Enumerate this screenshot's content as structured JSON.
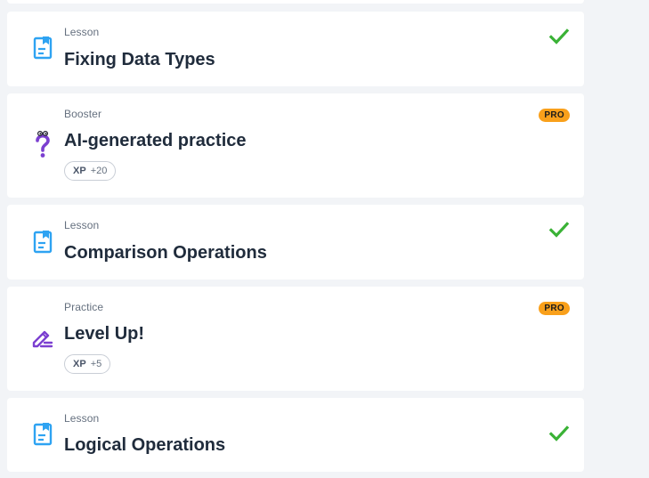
{
  "colors": {
    "lesson_icon": "#2ea3f2",
    "booster_icon": "#7b3fd0",
    "practice_icon": "#7b3fd0",
    "check": "#3ab236",
    "pro_badge": "#f9a01b"
  },
  "items": [
    {
      "kind": "Lesson",
      "title": "Fixing Data Types",
      "icon": "lesson-document-icon",
      "status": "completed"
    },
    {
      "kind": "Booster",
      "title": "AI-generated practice",
      "icon": "question-mark-icon",
      "badge": "PRO",
      "xp_label": "XP",
      "xp_value": "+20"
    },
    {
      "kind": "Lesson",
      "title": "Comparison Operations",
      "icon": "lesson-document-icon",
      "status": "completed"
    },
    {
      "kind": "Practice",
      "title": "Level Up!",
      "icon": "pencil-icon",
      "badge": "PRO",
      "xp_label": "XP",
      "xp_value": "+5"
    },
    {
      "kind": "Lesson",
      "title": "Logical Operations",
      "icon": "lesson-document-icon",
      "status": "completed"
    }
  ]
}
